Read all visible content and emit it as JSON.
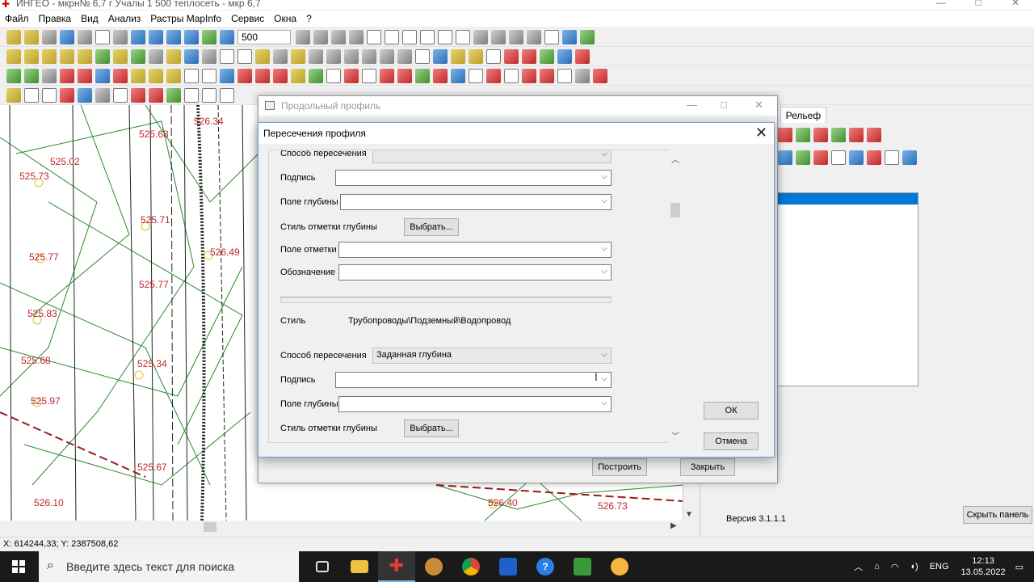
{
  "window": {
    "title": "ИНГЕО - мкрн№ 6,7 г Учалы 1 500 теплосеть - мкр 6,7",
    "icon": "ingeo-app-icon"
  },
  "menu": [
    "Файл",
    "Правка",
    "Вид",
    "Анализ",
    "Растры MapInfo",
    "Сервис",
    "Окна",
    "?"
  ],
  "toolbar": {
    "scale_value": "500"
  },
  "map": {
    "labels": [
      {
        "text": "525.02"
      },
      {
        "text": "525.73"
      },
      {
        "text": "525.71"
      },
      {
        "text": "525.77"
      },
      {
        "text": "525.83"
      },
      {
        "text": "525.68"
      },
      {
        "text": "525.97"
      },
      {
        "text": "526.10"
      },
      {
        "text": "525.67"
      },
      {
        "text": "525.34"
      },
      {
        "text": "526.49"
      },
      {
        "text": "525.68"
      },
      {
        "text": "525.77"
      },
      {
        "text": "526.40"
      },
      {
        "text": "526.73"
      },
      {
        "text": "526.34"
      }
    ],
    "coord_readout": "X: 614244,33; Y: 2387508,62"
  },
  "right_panel": {
    "tab": "Рельеф",
    "tab_partial": "ы",
    "version": "Версия 3.1.1.1",
    "hide_panel_button": "Скрыть панель"
  },
  "profile_dialog": {
    "title": "Продольный профиль",
    "build_button": "Построить",
    "close_button": "Закрыть"
  },
  "intersections_dialog": {
    "title": "Пересечения профиля",
    "section1": {
      "method_label": "Способ пересечения",
      "method_value": "",
      "caption_label": "Подпись",
      "caption_value": "",
      "depth_field_label": "Поле глубины",
      "depth_field_value": "",
      "depth_mark_style_label": "Стиль отметки глубины",
      "choose_button": "Выбрать...",
      "mark_field_label": "Поле отметки",
      "mark_field_value": "",
      "designation_label": "Обозначение",
      "designation_value": ""
    },
    "section2": {
      "style_label": "Стиль",
      "style_value": "Трубопроводы\\Подземный\\Водопровод",
      "method_label": "Способ пересечения",
      "method_value": "Заданная глубина",
      "caption_label": "Подпись",
      "caption_value": "",
      "depth_field_label": "Поле глубины",
      "depth_field_value": "",
      "depth_mark_style_label": "Стиль отметки глубины",
      "choose_button": "Выбрать..."
    },
    "ok_button": "ОК",
    "cancel_button": "Отмена"
  },
  "taskbar": {
    "search_placeholder": "Введите здесь текст для поиска",
    "language": "ENG",
    "time": "12:13",
    "date": "13.05.2022",
    "apps": [
      "task-view-icon",
      "file-explorer-icon",
      "ingeo-icon",
      "chess-app-icon",
      "chrome-icon",
      "calculator-icon",
      "help-icon",
      "spreadsheet-icon",
      "weather-icon"
    ]
  },
  "colors": {
    "map_label": "#c0282d",
    "map_line_green": "#2c8a2c",
    "selection_blue": "#0078d7",
    "taskbar_bg": "#1a1a1a"
  }
}
